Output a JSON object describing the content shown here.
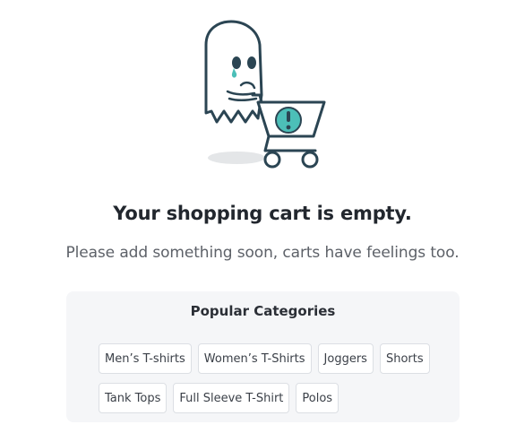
{
  "empty_cart": {
    "illustration_icon": "sad-ghost-cart-icon",
    "headline": "Your shopping cart is empty.",
    "subtext": "Please add something soon, carts have feelings too."
  },
  "popular_categories": {
    "title": "Popular Categories",
    "rows": [
      [
        "Men’s T-shirts",
        "Women’s T-Shirts",
        "Joggers",
        "Shorts"
      ],
      [
        "Tank Tops",
        "Full Sleeve T-Shirt",
        "Polos"
      ]
    ]
  },
  "colors": {
    "outline": "#2b4553",
    "accent": "#4cbfb8",
    "text_primary": "#22272e",
    "text_secondary": "#5d6168",
    "panel_bg": "#f5f6f8"
  }
}
